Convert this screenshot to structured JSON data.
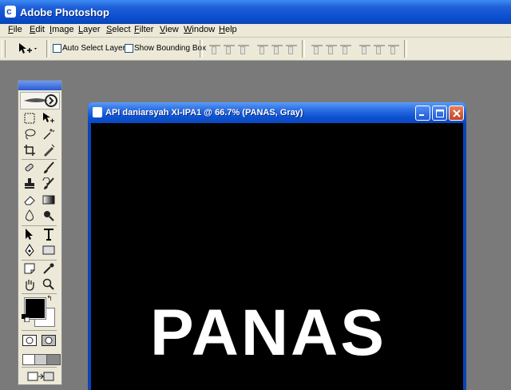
{
  "window": {
    "title": "Adobe Photoshop",
    "app_icon": "photoshop-icon"
  },
  "menubar": {
    "items": [
      "File",
      "Edit",
      "Image",
      "Layer",
      "Select",
      "Filter",
      "View",
      "Window",
      "Help"
    ]
  },
  "options_bar": {
    "tool_icon": "move-tool-icon",
    "auto_select_label": "Auto Select Layer",
    "auto_select_checked": false,
    "show_bounding_label": "Show Bounding Box",
    "show_bounding_checked": false
  },
  "toolbox": {
    "foreground_color": "#000000",
    "background_color": "#ffffff"
  },
  "document": {
    "title": "API daniarsyah XI-IPA1 @ 66.7% (PANAS, Gray)",
    "canvas_text": "PANAS",
    "canvas_color": "#000000",
    "text_color": "#ffffff"
  },
  "colors": {
    "title_bar": "#0b4fd0",
    "chrome": "#ece9d8",
    "workspace": "#7a7a7a",
    "close_button": "#c4441f"
  }
}
